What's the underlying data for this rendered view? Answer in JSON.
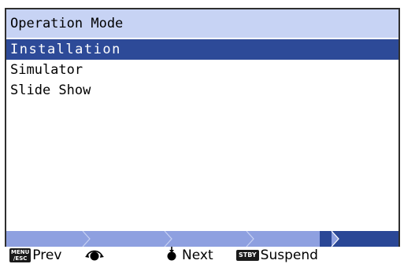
{
  "window": {
    "title": "Operation Mode"
  },
  "menu": {
    "items": [
      {
        "label": "Installation",
        "selected": true
      },
      {
        "label": "Simulator",
        "selected": false
      },
      {
        "label": "Slide Show",
        "selected": false
      }
    ]
  },
  "progress": {
    "steps": 4,
    "completed_fraction": 0.8,
    "fill_color": "#8ea0e0",
    "track_color": "#2a4796"
  },
  "footer": {
    "menu_esc_key": "MENU/ESC",
    "prev_label": "Prev",
    "scroll_icon": "scroll-wheel-icon",
    "next_icon": "knob-press-icon",
    "next_label": "Next",
    "stby_key": "STBY",
    "suspend_label": "Suspend"
  },
  "colors": {
    "title_bg": "#c7d3f4",
    "selected_bg": "#2d4a98",
    "frame_border": "#2f2f2f"
  }
}
